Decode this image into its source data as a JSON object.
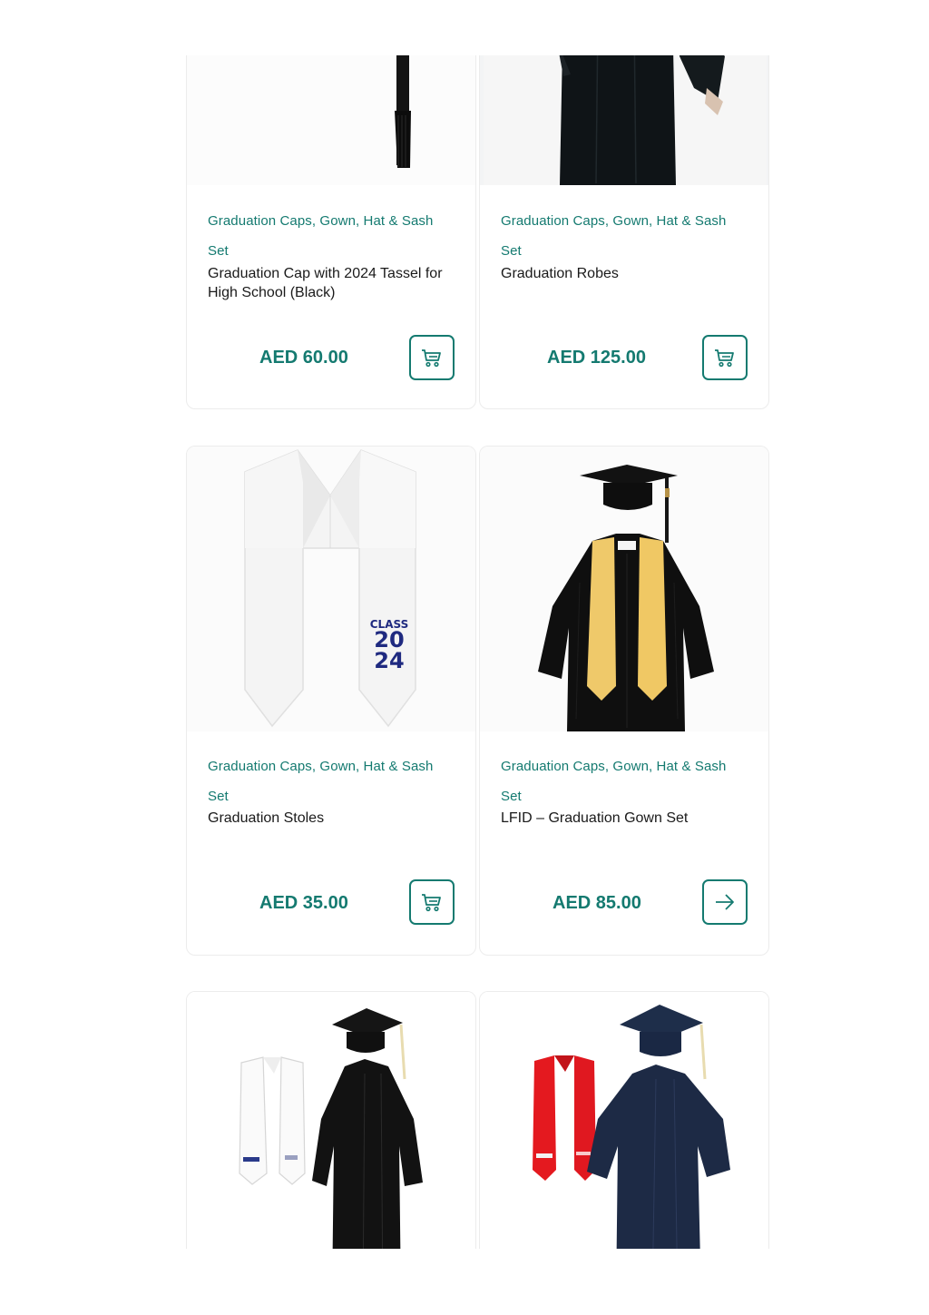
{
  "products": [
    {
      "category_line1": "Graduation Caps, Gown, Hat & Sash",
      "category_line2": "Set",
      "title": "Graduation Cap with 2024  Tassel for High School (Black)",
      "price": "AED 60.00",
      "action_icon": "cart-icon"
    },
    {
      "category_line1": "Graduation Caps, Gown, Hat & Sash",
      "category_line2": "Set",
      "title": "Graduation Robes",
      "price": "AED 125.00",
      "action_icon": "cart-icon"
    },
    {
      "category_line1": "Graduation Caps, Gown, Hat & Sash",
      "category_line2": "Set",
      "title": "Graduation Stoles",
      "price": "AED 35.00",
      "action_icon": "cart-icon"
    },
    {
      "category_line1": "Graduation Caps, Gown, Hat & Sash",
      "category_line2": "Set",
      "title": "LFID – Graduation Gown Set",
      "price": "AED 85.00",
      "action_icon": "arrow-right-icon"
    },
    {
      "product_icon": "black-gown-set-image"
    },
    {
      "product_icon": "navy-gown-set-image"
    }
  ],
  "stole_print": {
    "line1": "CLASS",
    "line2": "20",
    "line3": "24"
  },
  "colors": {
    "accent": "#147a70",
    "border": "#ececec",
    "stole_text": "#1f2a80"
  }
}
